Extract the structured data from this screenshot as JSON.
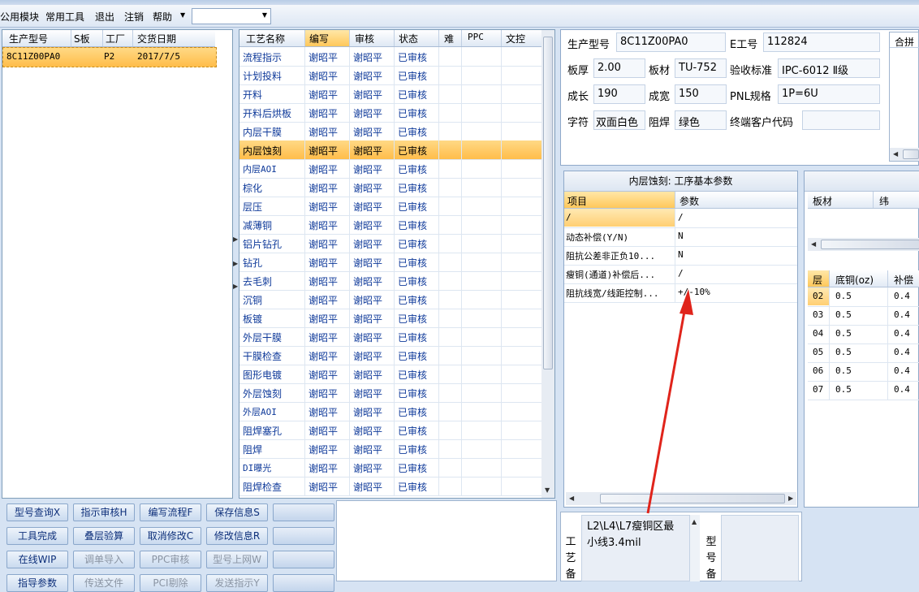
{
  "menu": {
    "items": [
      "公用模块",
      "常用工具",
      "退出",
      "注销",
      "帮助"
    ],
    "help_arrow": "▼",
    "combo_value": ""
  },
  "left_grid": {
    "headers": [
      "生产型号",
      "S板",
      "工厂",
      "交货日期"
    ],
    "rows": [
      [
        "8C11Z00PA0",
        "",
        "P2",
        "2017/7/5"
      ]
    ]
  },
  "process_grid": {
    "headers": [
      "工艺名称",
      "编写",
      "审核",
      "状态",
      "难",
      "PPC",
      "文控"
    ],
    "rows": [
      [
        "流程指示",
        "谢昭平",
        "谢昭平",
        "已审核"
      ],
      [
        "计划投料",
        "谢昭平",
        "谢昭平",
        "已审核"
      ],
      [
        "开料",
        "谢昭平",
        "谢昭平",
        "已审核"
      ],
      [
        "开料后烘板",
        "谢昭平",
        "谢昭平",
        "已审核"
      ],
      [
        "内层干膜",
        "谢昭平",
        "谢昭平",
        "已审核"
      ],
      [
        "内层蚀刻",
        "谢昭平",
        "谢昭平",
        "已审核"
      ],
      [
        "内层AOI",
        "谢昭平",
        "谢昭平",
        "已审核"
      ],
      [
        "棕化",
        "谢昭平",
        "谢昭平",
        "已审核"
      ],
      [
        "层压",
        "谢昭平",
        "谢昭平",
        "已审核"
      ],
      [
        "减薄铜",
        "谢昭平",
        "谢昭平",
        "已审核"
      ],
      [
        "铝片钻孔",
        "谢昭平",
        "谢昭平",
        "已审核"
      ],
      [
        "钻孔",
        "谢昭平",
        "谢昭平",
        "已审核"
      ],
      [
        "去毛刺",
        "谢昭平",
        "谢昭平",
        "已审核"
      ],
      [
        "沉铜",
        "谢昭平",
        "谢昭平",
        "已审核"
      ],
      [
        "板镀",
        "谢昭平",
        "谢昭平",
        "已审核"
      ],
      [
        "外层干膜",
        "谢昭平",
        "谢昭平",
        "已审核"
      ],
      [
        "干膜检查",
        "谢昭平",
        "谢昭平",
        "已审核"
      ],
      [
        "图形电镀",
        "谢昭平",
        "谢昭平",
        "已审核"
      ],
      [
        "外层蚀刻",
        "谢昭平",
        "谢昭平",
        "已审核"
      ],
      [
        "外层AOI",
        "谢昭平",
        "谢昭平",
        "已审核"
      ],
      [
        "阻焊塞孔",
        "谢昭平",
        "谢昭平",
        "已审核"
      ],
      [
        "阻焊",
        "谢昭平",
        "谢昭平",
        "已审核"
      ],
      [
        "DI曝光",
        "谢昭平",
        "谢昭平",
        "已审核"
      ],
      [
        "阻焊检查",
        "谢昭平",
        "谢昭平",
        "已审核"
      ]
    ]
  },
  "info": {
    "model_label": "生产型号",
    "model_value": "8C11Z00PA0",
    "eno_label": "E工号",
    "eno_value": "112824",
    "merge_label": "合拼",
    "thickness_label": "板厚",
    "thickness_value": "2.00",
    "material_label": "板材",
    "material_value": "TU-752",
    "standard_label": "验收标准",
    "standard_value": "IPC-6012 Ⅱ级",
    "length_label": "成长",
    "length_value": "190",
    "width_label": "成宽",
    "width_value": "150",
    "pnl_label": "PNL规格",
    "pnl_value": "1P=6U",
    "legend_label": "字符",
    "legend_value": "双面白色",
    "mask_label": "阻焊",
    "mask_value": "绿色",
    "customer_label": "终端客户代码",
    "customer_value": ""
  },
  "params": {
    "title": "内层蚀刻: 工序基本参数",
    "headers": [
      "项目",
      "参数"
    ],
    "rows": [
      [
        "/",
        "/"
      ],
      [
        "动态补偿(Y/N)",
        "N"
      ],
      [
        "阻抗公差非正负10...",
        "N"
      ],
      [
        "瘦铜(通道)补偿后...",
        "/"
      ],
      [
        "阻抗线宽/线距控制...",
        "+/-10%"
      ]
    ]
  },
  "right_panel": {
    "headers1": [
      "板材",
      "纬"
    ],
    "headers2": [
      "层",
      "底铜(oz)",
      "补偿"
    ],
    "rows": [
      [
        "02",
        "0.5",
        "0.4"
      ],
      [
        "03",
        "0.5",
        "0.4"
      ],
      [
        "04",
        "0.5",
        "0.4"
      ],
      [
        "05",
        "0.5",
        "0.4"
      ],
      [
        "06",
        "0.5",
        "0.4"
      ],
      [
        "07",
        "0.5",
        "0.4"
      ]
    ]
  },
  "buttons": {
    "row1": [
      "型号查询X",
      "指示审核H",
      "编写流程F",
      "保存信息S",
      ""
    ],
    "row2": [
      "工具完成",
      "叠层验算",
      "取消修改C",
      "修改信息R",
      ""
    ],
    "row3": [
      "在线WIP",
      "调单导入",
      "PPC审核",
      "型号上网W",
      ""
    ],
    "row4": [
      "指导参数",
      "传送文件",
      "PCI剔除",
      "发送指示Y",
      ""
    ]
  },
  "notes": {
    "process_label": "工艺备",
    "process_text": "L2\\L4\\L7瘦铜区最小线3.4mil",
    "model_label": "型号备"
  },
  "colors": {
    "selection": "#ffbd4a",
    "annotation_arrow": "#e0241b",
    "panel_bg": "#d6e3f3"
  }
}
